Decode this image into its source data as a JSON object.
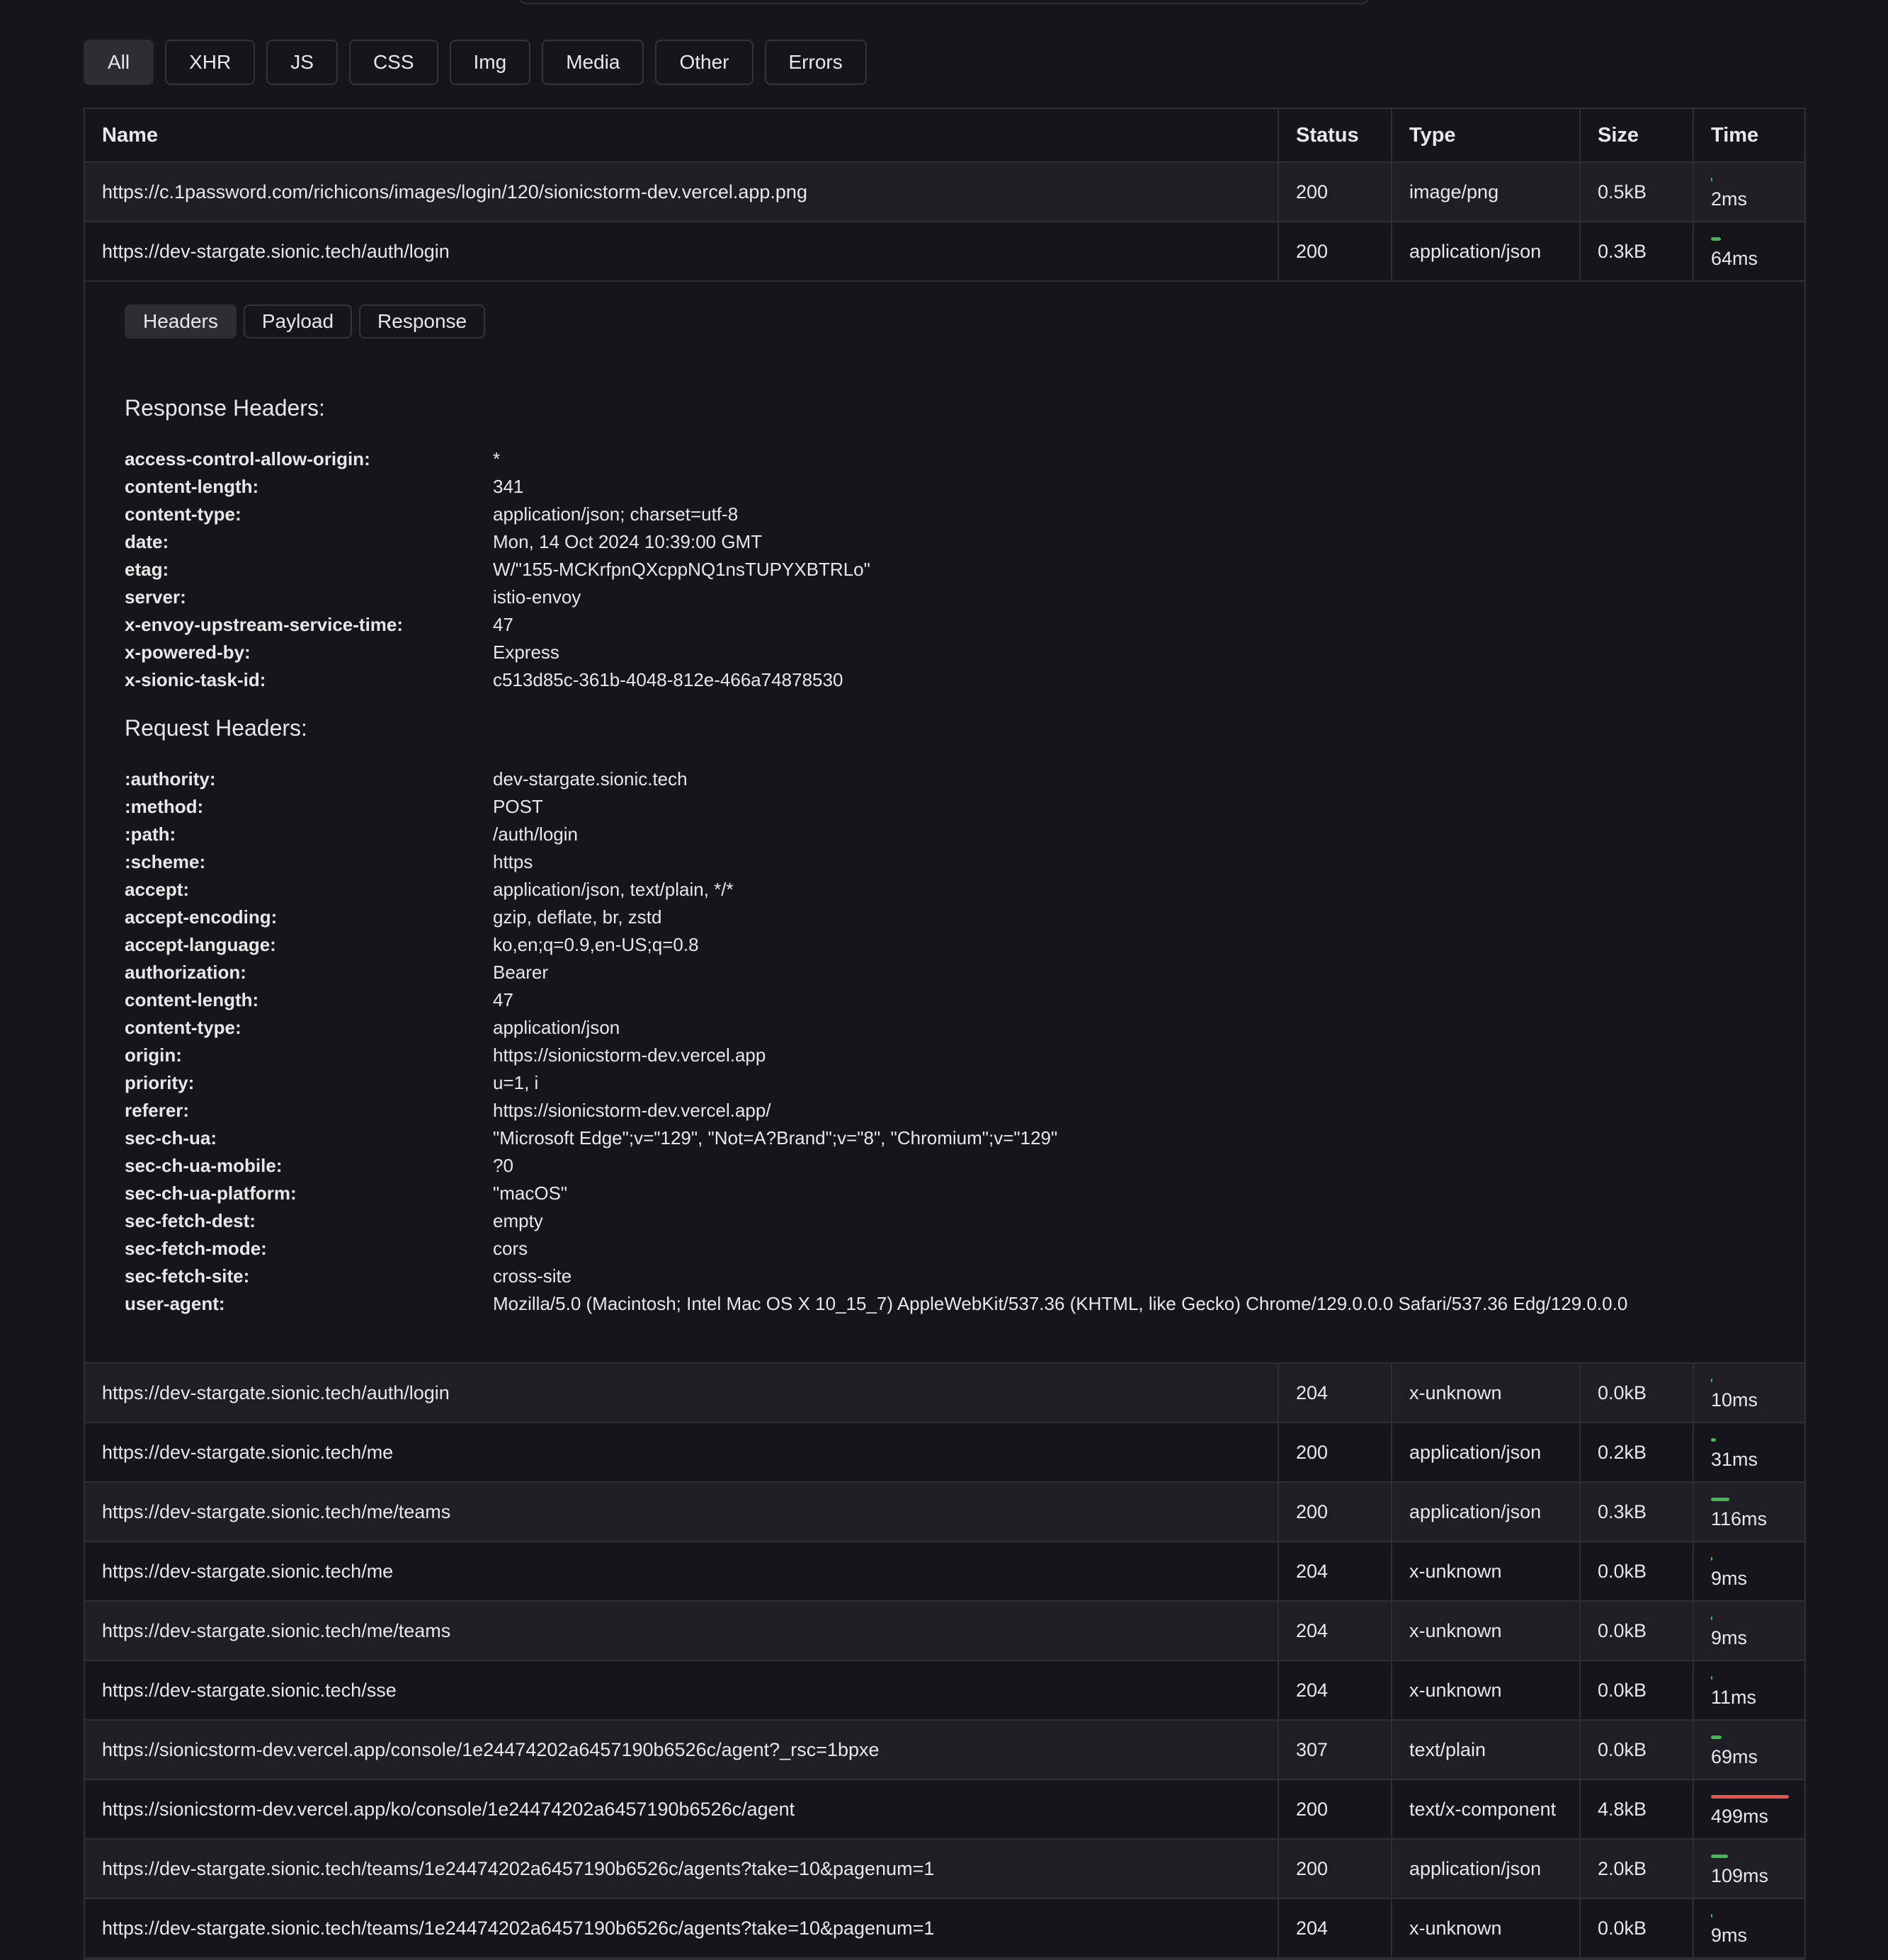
{
  "filters": [
    {
      "label": "All",
      "active": true
    },
    {
      "label": "XHR"
    },
    {
      "label": "JS"
    },
    {
      "label": "CSS"
    },
    {
      "label": "Img"
    },
    {
      "label": "Media"
    },
    {
      "label": "Other"
    },
    {
      "label": "Errors"
    }
  ],
  "columns": {
    "name": "Name",
    "status": "Status",
    "type": "Type",
    "size": "Size",
    "time": "Time"
  },
  "top_rows": [
    {
      "name": "https://c.1password.com/richicons/images/login/120/sionicstorm-dev.vercel.app.png",
      "status": "200",
      "type": "image/png",
      "size": "0.5kB",
      "time": "2ms",
      "ms": 2
    },
    {
      "name": "https://dev-stargate.sionic.tech/auth/login",
      "status": "200",
      "type": "application/json",
      "size": "0.3kB",
      "time": "64ms",
      "ms": 64
    }
  ],
  "detail": {
    "tabs": [
      "Headers",
      "Payload",
      "Response"
    ],
    "response_title": "Response Headers:",
    "response_headers": [
      {
        "k": "access-control-allow-origin:",
        "v": "*"
      },
      {
        "k": "content-length:",
        "v": "341"
      },
      {
        "k": "content-type:",
        "v": "application/json; charset=utf-8"
      },
      {
        "k": "date:",
        "v": "Mon, 14 Oct 2024 10:39:00 GMT"
      },
      {
        "k": "etag:",
        "v": "W/\"155-MCKrfpnQXcppNQ1nsTUPYXBTRLo\""
      },
      {
        "k": "server:",
        "v": "istio-envoy"
      },
      {
        "k": "x-envoy-upstream-service-time:",
        "v": "47"
      },
      {
        "k": "x-powered-by:",
        "v": "Express"
      },
      {
        "k": "x-sionic-task-id:",
        "v": "c513d85c-361b-4048-812e-466a74878530"
      }
    ],
    "request_title": "Request Headers:",
    "request_headers": [
      {
        "k": ":authority:",
        "v": "dev-stargate.sionic.tech"
      },
      {
        "k": ":method:",
        "v": "POST"
      },
      {
        "k": ":path:",
        "v": "/auth/login"
      },
      {
        "k": ":scheme:",
        "v": "https"
      },
      {
        "k": "accept:",
        "v": "application/json, text/plain, */*"
      },
      {
        "k": "accept-encoding:",
        "v": "gzip, deflate, br, zstd"
      },
      {
        "k": "accept-language:",
        "v": "ko,en;q=0.9,en-US;q=0.8"
      },
      {
        "k": "authorization:",
        "v": "Bearer"
      },
      {
        "k": "content-length:",
        "v": "47"
      },
      {
        "k": "content-type:",
        "v": "application/json"
      },
      {
        "k": "origin:",
        "v": "https://sionicstorm-dev.vercel.app"
      },
      {
        "k": "priority:",
        "v": "u=1, i"
      },
      {
        "k": "referer:",
        "v": "https://sionicstorm-dev.vercel.app/"
      },
      {
        "k": "sec-ch-ua:",
        "v": "\"Microsoft Edge\";v=\"129\", \"Not=A?Brand\";v=\"8\", \"Chromium\";v=\"129\""
      },
      {
        "k": "sec-ch-ua-mobile:",
        "v": "?0"
      },
      {
        "k": "sec-ch-ua-platform:",
        "v": "\"macOS\""
      },
      {
        "k": "sec-fetch-dest:",
        "v": "empty"
      },
      {
        "k": "sec-fetch-mode:",
        "v": "cors"
      },
      {
        "k": "sec-fetch-site:",
        "v": "cross-site"
      },
      {
        "k": "user-agent:",
        "v": "Mozilla/5.0 (Macintosh; Intel Mac OS X 10_15_7) AppleWebKit/537.36 (KHTML, like Gecko) Chrome/129.0.0.0 Safari/537.36 Edg/129.0.0.0"
      }
    ]
  },
  "bottom_rows": [
    {
      "name": "https://dev-stargate.sionic.tech/auth/login",
      "status": "204",
      "type": "x-unknown",
      "size": "0.0kB",
      "time": "10ms",
      "ms": 10
    },
    {
      "name": "https://dev-stargate.sionic.tech/me",
      "status": "200",
      "type": "application/json",
      "size": "0.2kB",
      "time": "31ms",
      "ms": 31
    },
    {
      "name": "https://dev-stargate.sionic.tech/me/teams",
      "status": "200",
      "type": "application/json",
      "size": "0.3kB",
      "time": "116ms",
      "ms": 116
    },
    {
      "name": "https://dev-stargate.sionic.tech/me",
      "status": "204",
      "type": "x-unknown",
      "size": "0.0kB",
      "time": "9ms",
      "ms": 9
    },
    {
      "name": "https://dev-stargate.sionic.tech/me/teams",
      "status": "204",
      "type": "x-unknown",
      "size": "0.0kB",
      "time": "9ms",
      "ms": 9
    },
    {
      "name": "https://dev-stargate.sionic.tech/sse",
      "status": "204",
      "type": "x-unknown",
      "size": "0.0kB",
      "time": "11ms",
      "ms": 11
    },
    {
      "name": "https://sionicstorm-dev.vercel.app/console/1e24474202a6457190b6526c/agent?_rsc=1bpxe",
      "status": "307",
      "type": "text/plain",
      "size": "0.0kB",
      "time": "69ms",
      "ms": 69
    },
    {
      "name": "https://sionicstorm-dev.vercel.app/ko/console/1e24474202a6457190b6526c/agent",
      "status": "200",
      "type": "text/x-component",
      "size": "4.8kB",
      "time": "499ms",
      "ms": 499
    },
    {
      "name": "https://dev-stargate.sionic.tech/teams/1e24474202a6457190b6526c/agents?take=10&pagenum=1",
      "status": "200",
      "type": "application/json",
      "size": "2.0kB",
      "time": "109ms",
      "ms": 109
    },
    {
      "name": "https://dev-stargate.sionic.tech/teams/1e24474202a6457190b6526c/agents?take=10&pagenum=1",
      "status": "204",
      "type": "x-unknown",
      "size": "0.0kB",
      "time": "9ms",
      "ms": 9
    }
  ],
  "colors": {
    "fast_bar": "#3fb950",
    "slow_bar": "#e5534b"
  }
}
